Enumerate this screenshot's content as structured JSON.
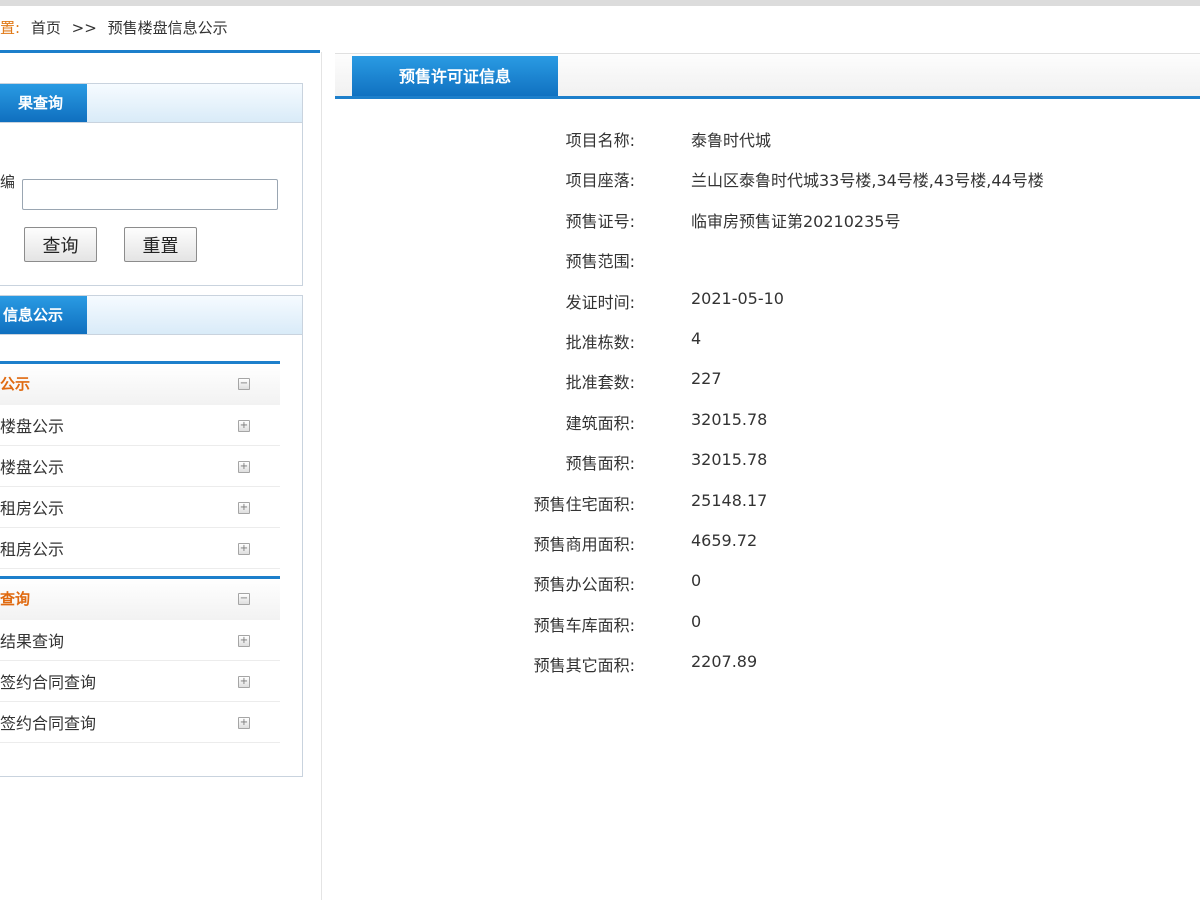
{
  "breadcrumb": {
    "label": "置:",
    "home": "首页",
    "separator": ">>",
    "current": "预售楼盘信息公示"
  },
  "query_panel": {
    "title": "果查询",
    "field_label": "编",
    "field_value": "",
    "query_button": "查询",
    "reset_button": "重置"
  },
  "info_panel": {
    "title": "信息公示",
    "groups": [
      {
        "label": "公示",
        "toggle": "−",
        "items": [
          {
            "label": "楼盘公示",
            "toggle": "+"
          },
          {
            "label": "楼盘公示",
            "toggle": "+"
          },
          {
            "label": "租房公示",
            "toggle": "+"
          },
          {
            "label": "租房公示",
            "toggle": "+"
          }
        ]
      },
      {
        "label": "查询",
        "toggle": "−",
        "items": [
          {
            "label": "结果查询",
            "toggle": "+"
          },
          {
            "label": "签约合同查询",
            "toggle": "+"
          },
          {
            "label": "签约合同查询",
            "toggle": "+"
          }
        ]
      }
    ]
  },
  "content": {
    "tab_title": "预售许可证信息",
    "rows": [
      {
        "key": "项目名称:",
        "value": "泰鲁时代城"
      },
      {
        "key": "项目座落:",
        "value": "兰山区泰鲁时代城33号楼,34号楼,43号楼,44号楼"
      },
      {
        "key": "预售证号:",
        "value": "临审房预售证第20210235号"
      },
      {
        "key": "预售范围:",
        "value": ""
      },
      {
        "key": "发证时间:",
        "value": "2021-05-10"
      },
      {
        "key": "批准栋数:",
        "value": "4"
      },
      {
        "key": "批准套数:",
        "value": "227"
      },
      {
        "key": "建筑面积:",
        "value": "32015.78"
      },
      {
        "key": "预售面积:",
        "value": "32015.78"
      },
      {
        "key": "预售住宅面积:",
        "value": "25148.17"
      },
      {
        "key": "预售商用面积:",
        "value": "4659.72"
      },
      {
        "key": "预售办公面积:",
        "value": "0"
      },
      {
        "key": "预售车库面积:",
        "value": "0"
      },
      {
        "key": "预售其它面积:",
        "value": "2207.89"
      }
    ]
  },
  "colors": {
    "accent_blue": "#1d7fcb",
    "menu_group_orange": "#e06a10",
    "breadcrumb_orange": "#e07a18"
  }
}
